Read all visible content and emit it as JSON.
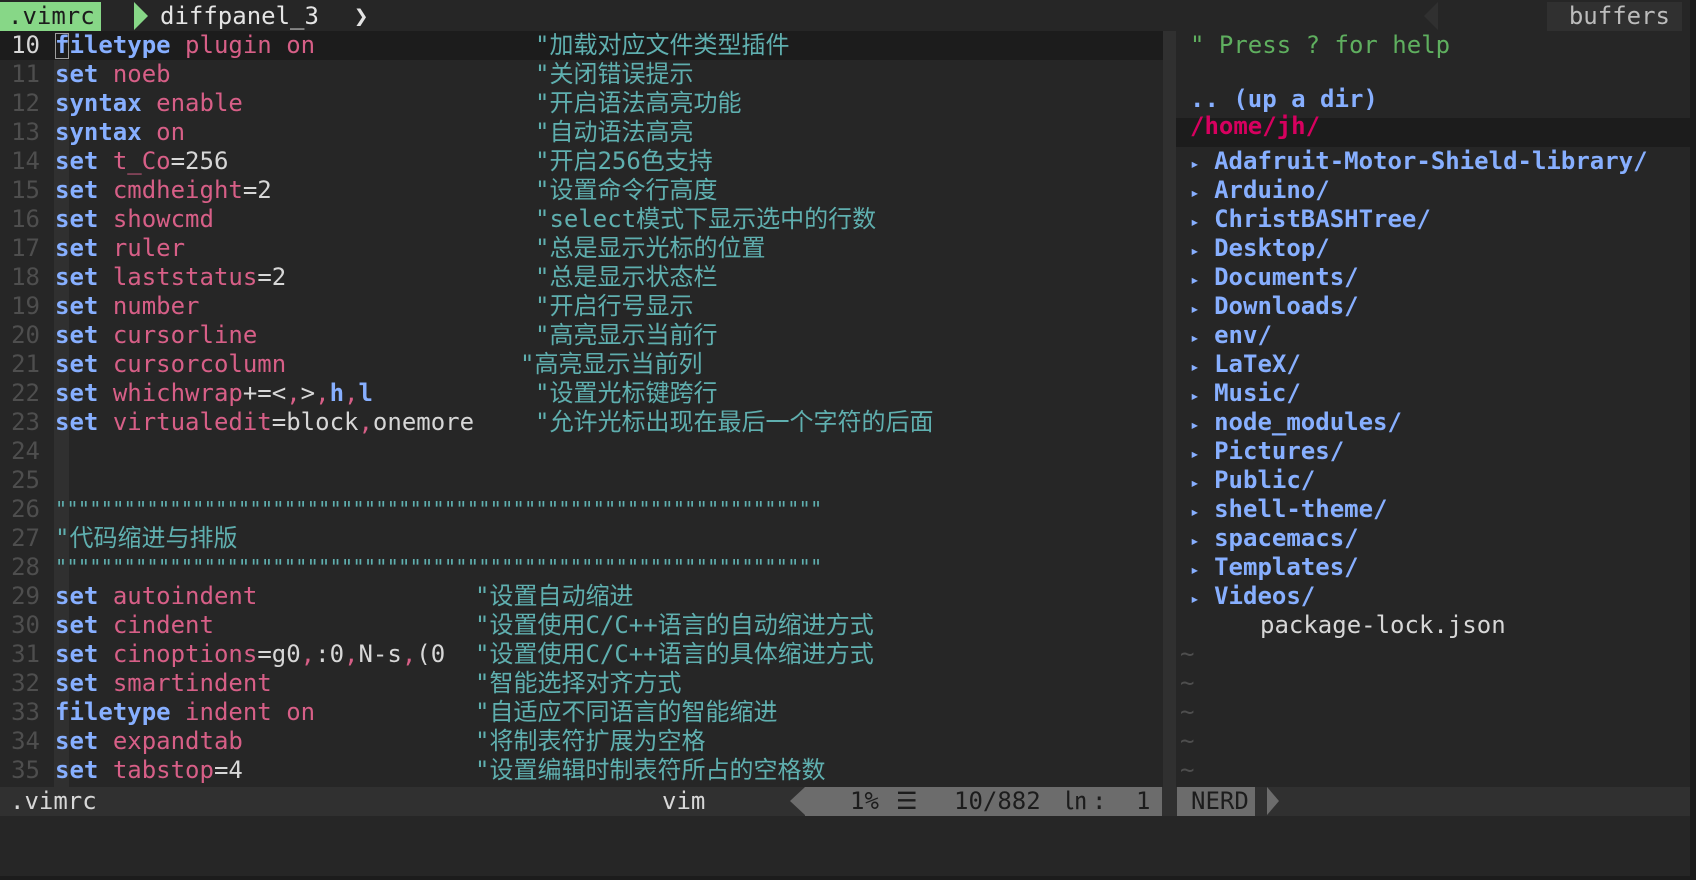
{
  "tabline": {
    "active_tab": ".vimrc",
    "inactive_tab": "diffpanel_3",
    "file_icon": "",
    "buffers_label": "buffers"
  },
  "editor": {
    "lines": [
      {
        "num": "10",
        "kw": "filetype",
        "rest": [
          {
            "t": "plugin on",
            "c": "val"
          }
        ],
        "comment": "\"加载对应文件类型插件",
        "col": 535,
        "current": true
      },
      {
        "num": "11",
        "kw": "set",
        "rest": [
          {
            "t": "noeb",
            "c": "val"
          }
        ],
        "comment": "\"关闭错误提示",
        "col": 535
      },
      {
        "num": "12",
        "kw": "syntax",
        "rest": [
          {
            "t": "enable",
            "c": "val"
          }
        ],
        "comment": "\"开启语法高亮功能",
        "col": 535
      },
      {
        "num": "13",
        "kw": "syntax",
        "rest": [
          {
            "t": "on",
            "c": "val"
          }
        ],
        "comment": "\"自动语法高亮",
        "col": 535
      },
      {
        "num": "14",
        "kw": "set",
        "rest": [
          {
            "t": "t_Co",
            "c": "val"
          },
          {
            "t": "=256",
            "c": "op"
          }
        ],
        "comment": "\"开启256色支持",
        "col": 535
      },
      {
        "num": "15",
        "kw": "set",
        "rest": [
          {
            "t": "cmdheight",
            "c": "val"
          },
          {
            "t": "=2",
            "c": "op"
          }
        ],
        "comment": "\"设置命令行高度",
        "col": 535
      },
      {
        "num": "16",
        "kw": "set",
        "rest": [
          {
            "t": "showcmd",
            "c": "val"
          }
        ],
        "comment": "\"select模式下显示选中的行数",
        "col": 535
      },
      {
        "num": "17",
        "kw": "set",
        "rest": [
          {
            "t": "ruler",
            "c": "val"
          }
        ],
        "comment": "\"总是显示光标的位置",
        "col": 535
      },
      {
        "num": "18",
        "kw": "set",
        "rest": [
          {
            "t": "laststatus",
            "c": "val"
          },
          {
            "t": "=2",
            "c": "op"
          }
        ],
        "comment": "\"总是显示状态栏",
        "col": 535
      },
      {
        "num": "19",
        "kw": "set",
        "rest": [
          {
            "t": "number",
            "c": "val"
          }
        ],
        "comment": "\"开启行号显示",
        "col": 535
      },
      {
        "num": "20",
        "kw": "set",
        "rest": [
          {
            "t": "cursorline",
            "c": "val"
          }
        ],
        "comment": "\"高亮显示当前行",
        "col": 535
      },
      {
        "num": "21",
        "kw": "set",
        "rest": [
          {
            "t": "cursorcolumn",
            "c": "val"
          }
        ],
        "comment": "\"高亮显示当前列",
        "col": 520
      },
      {
        "num": "22",
        "kw": "set",
        "rest": [
          {
            "t": "whichwrap",
            "c": "val"
          },
          {
            "t": "+=<",
            "c": "op"
          },
          {
            "t": ",",
            "c": "val"
          },
          {
            "t": ">",
            "c": "op"
          },
          {
            "t": ",",
            "c": "val"
          },
          {
            "t": "h",
            "c": "kw"
          },
          {
            "t": ",",
            "c": "val"
          },
          {
            "t": "l",
            "c": "kw"
          }
        ],
        "comment": "\"设置光标键跨行",
        "col": 535
      },
      {
        "num": "23",
        "kw": "set",
        "rest": [
          {
            "t": "virtualedit",
            "c": "val"
          },
          {
            "t": "=block",
            "c": "op"
          },
          {
            "t": ",",
            "c": "val"
          },
          {
            "t": "onemore",
            "c": "op"
          }
        ],
        "comment": "\"允许光标出现在最后一个字符的后面",
        "col": 535
      },
      {
        "num": "24",
        "kw": "",
        "rest": [],
        "comment": "",
        "col": 0
      },
      {
        "num": "25",
        "kw": "",
        "rest": [],
        "comment": "",
        "col": 0
      },
      {
        "num": "26",
        "kw": "",
        "rest": [],
        "comment": "\"\"\"\"\"\"\"\"\"\"\"\"\"\"\"\"\"\"\"\"\"\"\"\"\"\"\"\"\"\"\"\"\"\"\"\"\"\"\"\"\"\"\"\"\"\"\"\"\"\"\"\"\"\"\"\"\"\"\"\"\"\"\"\"\"\"\"",
        "col": 55
      },
      {
        "num": "27",
        "kw": "",
        "rest": [],
        "comment": "\"代码缩进与排版",
        "col": 55
      },
      {
        "num": "28",
        "kw": "",
        "rest": [],
        "comment": "\"\"\"\"\"\"\"\"\"\"\"\"\"\"\"\"\"\"\"\"\"\"\"\"\"\"\"\"\"\"\"\"\"\"\"\"\"\"\"\"\"\"\"\"\"\"\"\"\"\"\"\"\"\"\"\"\"\"\"\"\"\"\"\"\"\"\"",
        "col": 55
      },
      {
        "num": "29",
        "kw": "set",
        "rest": [
          {
            "t": "autoindent",
            "c": "val"
          }
        ],
        "comment": "\"设置自动缩进",
        "col": 475
      },
      {
        "num": "30",
        "kw": "set",
        "rest": [
          {
            "t": "cindent",
            "c": "val"
          }
        ],
        "comment": "\"设置使用C/C++语言的自动缩进方式",
        "col": 475
      },
      {
        "num": "31",
        "kw": "set",
        "rest": [
          {
            "t": "cinoptions",
            "c": "val"
          },
          {
            "t": "=g0",
            "c": "op"
          },
          {
            "t": ",",
            "c": "val"
          },
          {
            "t": ":0",
            "c": "op"
          },
          {
            "t": ",",
            "c": "val"
          },
          {
            "t": "N-s",
            "c": "op"
          },
          {
            "t": ",",
            "c": "val"
          },
          {
            "t": "(0",
            "c": "op"
          }
        ],
        "comment": "\"设置使用C/C++语言的具体缩进方式",
        "col": 475
      },
      {
        "num": "32",
        "kw": "set",
        "rest": [
          {
            "t": "smartindent",
            "c": "val"
          }
        ],
        "comment": "\"智能选择对齐方式",
        "col": 475
      },
      {
        "num": "33",
        "kw": "filetype",
        "rest": [
          {
            "t": "indent on",
            "c": "val"
          }
        ],
        "comment": "\"自适应不同语言的智能缩进",
        "col": 475
      },
      {
        "num": "34",
        "kw": "set",
        "rest": [
          {
            "t": "expandtab",
            "c": "val"
          }
        ],
        "comment": "\"将制表符扩展为空格",
        "col": 475
      },
      {
        "num": "35",
        "kw": "set",
        "rest": [
          {
            "t": "tabstop",
            "c": "val"
          },
          {
            "t": "=4",
            "c": "op"
          }
        ],
        "comment": "\"设置编辑时制表符所占的空格数",
        "col": 475
      }
    ]
  },
  "nerdtree": {
    "help": "\" Press ? for help",
    "updir": ".. (up a dir)",
    "root": "/home/jh/",
    "dirs": [
      "Adafruit-Motor-Shield-library/",
      "Arduino/",
      "ChristBASHTree/",
      "Desktop/",
      "Documents/",
      "Downloads/",
      "env/",
      "LaTeX/",
      "Music/",
      "node_modules/",
      "Pictures/",
      "Public/",
      "shell-theme/",
      "spacemacs/",
      "Templates/",
      "Videos/"
    ],
    "dir_arrow": "▸",
    "file": "package-lock.json",
    "file_icon": "",
    "tilde": "~",
    "tilde_count": 5
  },
  "statusline": {
    "filename": ".vimrc",
    "filetype": "vim",
    "filetype_icon": "",
    "percent": "1%",
    "lines_icon": "☰",
    "position": "10/882",
    "ln_icon": "㏑",
    "colon": ":",
    "column": "1",
    "nerd_label": "NERD"
  },
  "colors": {
    "background": "#262626",
    "tab_active": "#87d787",
    "keyword": "#87afff",
    "value": "#d75f87",
    "comment": "#5fafaf",
    "help": "#5faf5f",
    "root": "#d7005f"
  }
}
